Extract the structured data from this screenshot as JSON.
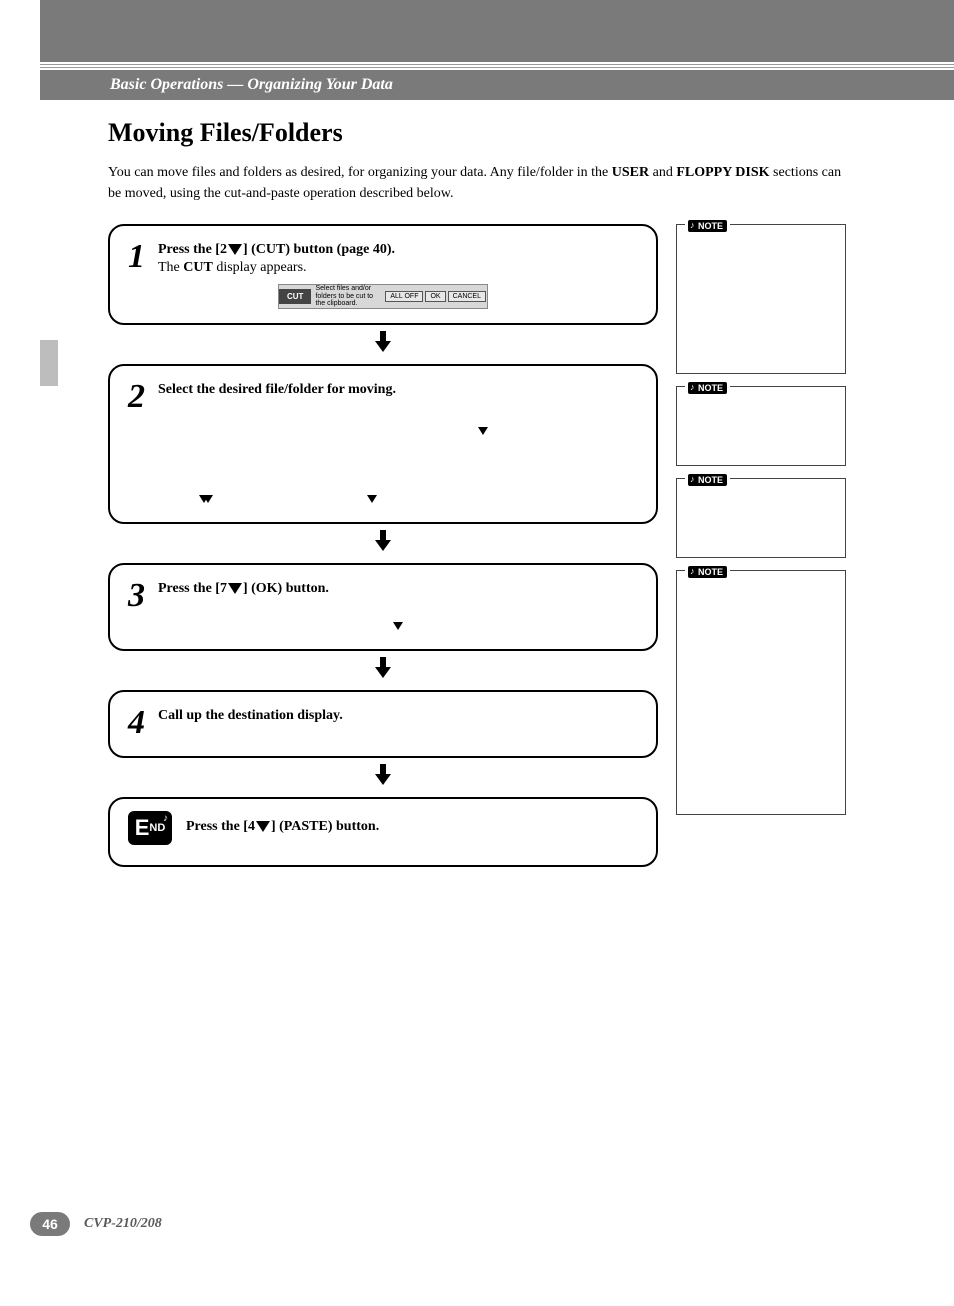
{
  "breadcrumb": "Basic Operations — Organizing Your Data",
  "heading": "Moving Files/Folders",
  "intro_pre": "You can move files and folders as desired, for organizing your data. Any file/folder in the ",
  "intro_b1": "USER",
  "intro_mid": " and ",
  "intro_b2": "FLOPPY DISK",
  "intro_post": " sections can be moved, using the cut-and-paste operation described below.",
  "step1": {
    "num": "1",
    "line_a": "Press the [2",
    "line_b": "] (CUT) button (page 40).",
    "sub_a": "The ",
    "sub_b": "CUT",
    "sub_c": " display appears."
  },
  "cutstrip": {
    "label": "CUT",
    "msg": "Select files and/or folders to be cut to the clipboard.",
    "b1": "ALL OFF",
    "b2": "OK",
    "b3": "CANCEL"
  },
  "step2": {
    "num": "2",
    "text": "Select the desired file/folder for moving."
  },
  "step3": {
    "num": "3",
    "text_a": "Press the [7",
    "text_b": "] (OK) button."
  },
  "step4": {
    "num": "4",
    "text": "Call up the destination display."
  },
  "step5": {
    "label": "END",
    "text_a": "Press the [4",
    "text_b": "] (PASTE) button."
  },
  "note_label": "NOTE",
  "footer": {
    "page": "46",
    "model": "CVP-210/208"
  }
}
